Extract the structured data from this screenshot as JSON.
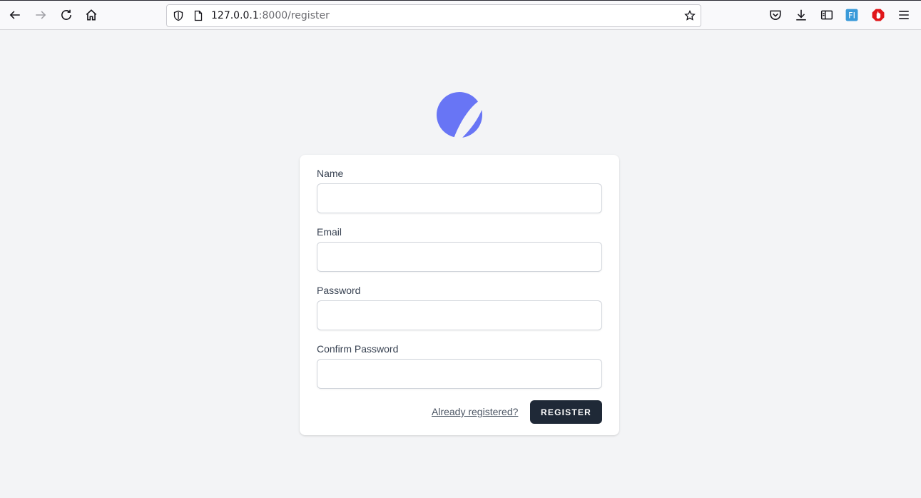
{
  "browser": {
    "url_host": "127.0.0.1",
    "url_rest": ":8000/register",
    "icons": [
      "back-arrow-icon",
      "forward-arrow-icon",
      "reload-icon",
      "home-icon",
      "shield-icon",
      "page-icon",
      "bookmark-star-icon",
      "pocket-icon",
      "download-icon",
      "reader-view-icon",
      "extension-icon",
      "adblock-icon",
      "menu-icon"
    ]
  },
  "form": {
    "name_label": "Name",
    "email_label": "Email",
    "password_label": "Password",
    "confirm_label": "Confirm Password",
    "name_value": "",
    "email_value": "",
    "password_value": "",
    "confirm_value": "",
    "login_link": "Already registered?",
    "register_button": "REGISTER"
  },
  "colors": {
    "background": "#f3f4f6",
    "logo": "#6875f5",
    "button": "#1f2937",
    "label": "#374151"
  }
}
